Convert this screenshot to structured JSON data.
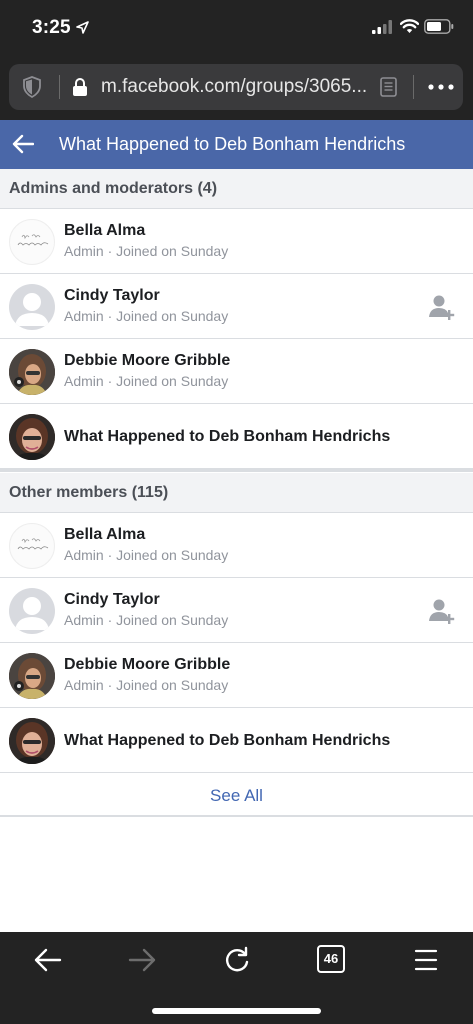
{
  "status_bar": {
    "time": "3:25"
  },
  "browser": {
    "url": "m.facebook.com/groups/3065...",
    "tab_count": "46"
  },
  "header": {
    "title": "What Happened to Deb Bonham Hendrichs"
  },
  "admins_section": {
    "label": "Admins and moderators (4)",
    "members": [
      {
        "name": "Bella Alma",
        "meta": "Admin · Joined on Sunday"
      },
      {
        "name": "Cindy Taylor",
        "meta": "Admin · Joined on Sunday"
      },
      {
        "name": "Debbie Moore Gribble",
        "meta": "Admin · Joined on Sunday"
      },
      {
        "name": "What Happened to Deb Bonham Hendrichs",
        "meta": ""
      }
    ]
  },
  "members_section": {
    "label": "Other members (115)",
    "members": [
      {
        "name": "Bella Alma",
        "meta": "Admin · Joined on Sunday"
      },
      {
        "name": "Cindy Taylor",
        "meta": "Admin · Joined on Sunday"
      },
      {
        "name": "Debbie Moore Gribble",
        "meta": "Admin · Joined on Sunday"
      },
      {
        "name": "What Happened to Deb Bonham Hendrichs",
        "meta": ""
      }
    ],
    "see_all": "See All"
  },
  "bella_avatar_script": "I'm a sweet dreamer",
  "colors": {
    "fb_blue": "#4a67a8",
    "link_blue": "#4267b2",
    "browser_chrome": "#232323"
  },
  "icons": [
    "location-arrow-icon",
    "signal-icon",
    "wifi-icon",
    "battery-icon",
    "shield-icon",
    "lock-icon",
    "reader-icon",
    "more-icon",
    "back-arrow-icon",
    "add-friend-icon",
    "forward-arrow-icon",
    "reload-icon",
    "menu-icon"
  ]
}
